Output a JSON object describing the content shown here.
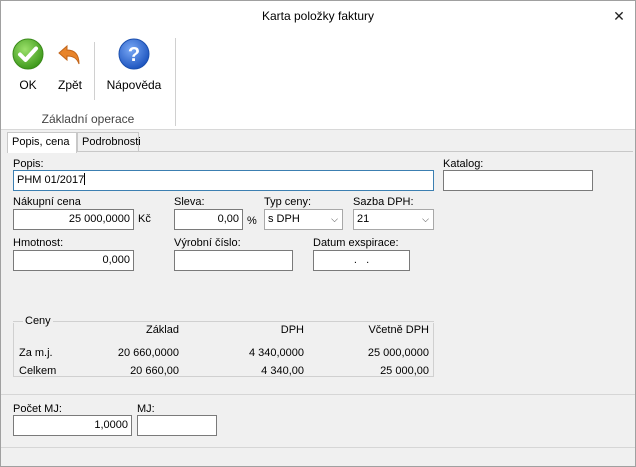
{
  "window": {
    "title": "Karta položky faktury"
  },
  "ribbon": {
    "ok_label": "OK",
    "back_label": "Zpět",
    "help_label": "Nápověda",
    "group_label": "Základní operace"
  },
  "tabs": [
    {
      "label": "Popis, cena",
      "active": true
    },
    {
      "label": "Podrobnosti",
      "active": false
    }
  ],
  "form": {
    "popis_label": "Popis:",
    "popis_value": "PHM 01/2017",
    "katalog_label": "Katalog:",
    "katalog_value": "",
    "nakupni_cena_label": "Nákupní cena",
    "nakupni_cena_value": "25 000,0000",
    "currency": "Kč",
    "sleva_label": "Sleva:",
    "sleva_value": "0,00",
    "percent": "%",
    "typ_ceny_label": "Typ ceny:",
    "typ_ceny_value": "s DPH",
    "sazba_dph_label": "Sazba DPH:",
    "sazba_dph_value": "21",
    "hmotnost_label": "Hmotnost:",
    "hmotnost_value": "0,000",
    "vyrobni_cislo_label": "Výrobní číslo:",
    "vyrobni_cislo_value": "",
    "datum_exspirace_label": "Datum exspirace:",
    "datum_exspirace_value": ".   ."
  },
  "ceny": {
    "caption": "Ceny",
    "headers": [
      "Základ",
      "DPH",
      "Včetně DPH"
    ],
    "rows": [
      {
        "label": "Za m.j.",
        "zaklad": "20 660,0000",
        "dph": "4 340,0000",
        "vcetne": "25 000,0000"
      },
      {
        "label": "Celkem",
        "zaklad": "20 660,00",
        "dph": "4 340,00",
        "vcetne": "25 000,00"
      }
    ]
  },
  "bottom": {
    "pocet_mj_label": "Počet MJ:",
    "pocet_mj_value": "1,0000",
    "mj_label": "MJ:",
    "mj_value": ""
  },
  "colors": {
    "ok_green": "#5cb82e",
    "back_orange": "#e8842a",
    "help_blue": "#2f6fd6",
    "focus_border": "#3c7fb1"
  }
}
